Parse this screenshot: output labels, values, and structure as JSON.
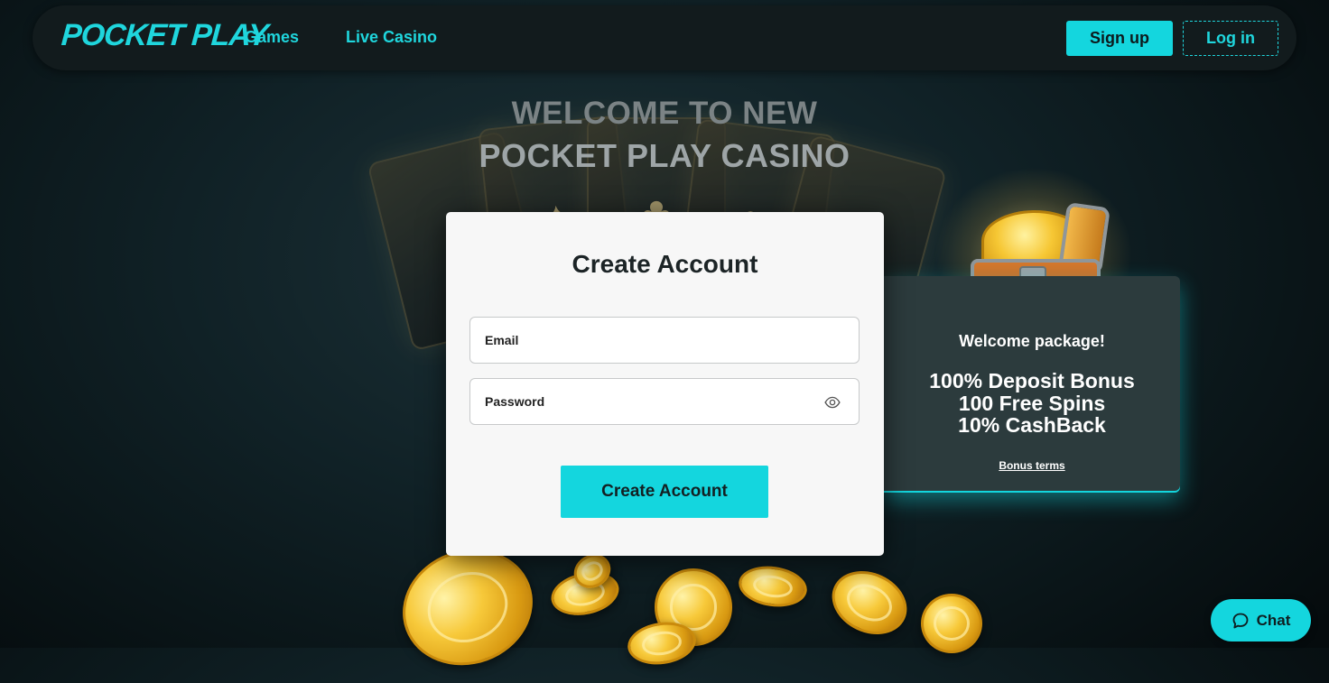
{
  "header": {
    "logo": "POCKET PLAY",
    "nav": [
      {
        "label": "Games"
      },
      {
        "label": "Live Casino"
      }
    ],
    "signup_label": "Sign up",
    "login_label": "Log in"
  },
  "hero": {
    "line1": "WELCOME TO NEW",
    "line2": "POCKET PLAY CASINO"
  },
  "form": {
    "title": "Create Account",
    "email_label": "Email",
    "password_label": "Password",
    "submit_label": "Create Account"
  },
  "promo": {
    "heading": "Welcome package!",
    "lines": [
      "100% Deposit Bonus",
      "100 Free Spins",
      "10% CashBack"
    ],
    "terms_link": "Bonus terms"
  },
  "chat": {
    "label": "Chat"
  },
  "colors": {
    "accent": "#14d6de",
    "header_bg": "#121b1d",
    "card_bg": "#f7f7f7",
    "promo_bg": "#2c3b3d"
  },
  "icons": {
    "show_password": "eye-icon",
    "chat": "chat-bubble-icon"
  }
}
